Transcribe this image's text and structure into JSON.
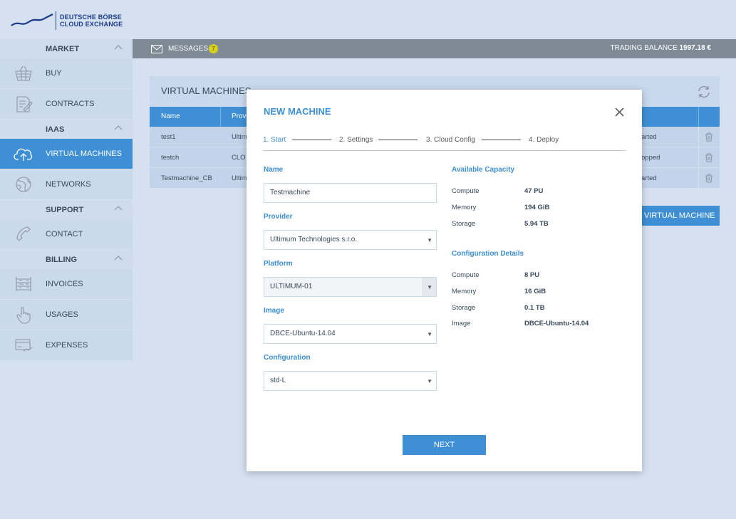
{
  "brand": {
    "line1": "DEUTSCHE BÖRSE",
    "line2": "CLOUD EXCHANGE"
  },
  "sidebar": {
    "market": "MARKET",
    "buy": "BUY",
    "contracts": "CONTRACTS",
    "iaas": "IAAS",
    "virtual_machines": "VIRTUAL MACHINES",
    "networks": "NETWORKS",
    "support": "SUPPORT",
    "contact": "CONTACT",
    "billing": "BILLING",
    "invoices": "INVOICES",
    "usages": "USAGES",
    "expenses": "EXPENSES"
  },
  "topbar": {
    "messages_label": "MESSAGES",
    "messages_count": "7",
    "balance_label": "TRADING BALANCE",
    "balance_value": "1997.18 €"
  },
  "vm_panel": {
    "title": "VIRTUAL MACHINES",
    "col_name": "Name",
    "col_provider": "Provi",
    "rows": [
      {
        "name": "test1",
        "provider": "Ultim",
        "status": "arted"
      },
      {
        "name": "testch",
        "provider": "CLO",
        "status": "opped"
      },
      {
        "name": "Testmachine_CB",
        "provider": "Ultim",
        "status": "arted"
      }
    ],
    "add_button": "VIRTUAL MACHINE"
  },
  "modal": {
    "title": "NEW MACHINE",
    "steps": [
      "1. Start",
      "2. Settings",
      "3. Cloud Config",
      "4. Deploy"
    ],
    "name_label": "Name",
    "name_value": "Testmachine",
    "provider_label": "Provider",
    "provider_value": "Ultimum Technologies s.r.o.",
    "platform_label": "Platform",
    "platform_value": "ULTIMUM-01",
    "image_label": "Image",
    "image_value": "DBCE-Ubuntu-14.04",
    "configuration_label": "Configuration",
    "configuration_value": "std-L",
    "available_title": "Available Capacity",
    "available": {
      "compute_label": "Compute",
      "compute_value": "47 PU",
      "memory_label": "Memory",
      "memory_value": "194 GiB",
      "storage_label": "Storage",
      "storage_value": "5.94 TB"
    },
    "config_title": "Configuration Details",
    "config": {
      "compute_label": "Compute",
      "compute_value": "8 PU",
      "memory_label": "Memory",
      "memory_value": "16 GiB",
      "storage_label": "Storage",
      "storage_value": "0.1 TB",
      "image_label": "Image",
      "image_value": "DBCE-Ubuntu-14.04"
    },
    "next_button": "NEXT"
  },
  "colors": {
    "accent": "#3e8fd4",
    "brand": "#1a3a8a",
    "badge": "#d8d31a"
  }
}
